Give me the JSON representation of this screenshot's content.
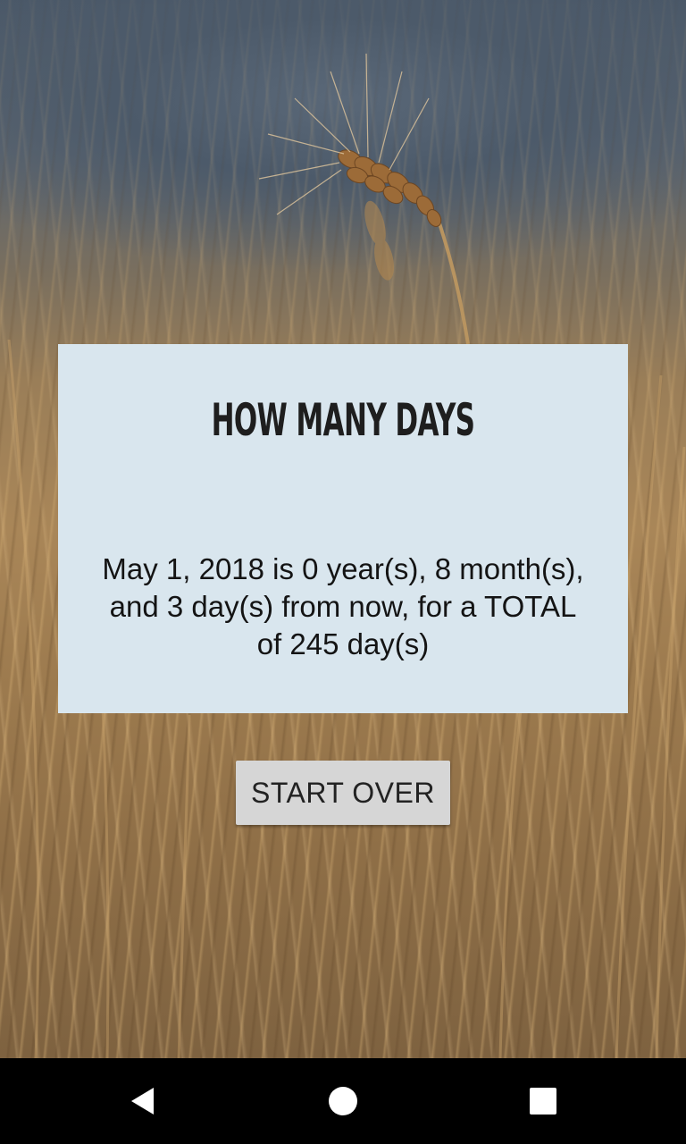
{
  "app": {
    "title": "HOW MANY DAYS"
  },
  "result": {
    "text": "May 1, 2018 is 0 year(s), 8 month(s), and 3 day(s)  from now, for a TOTAL of 245 day(s)",
    "card_color": "#d9e6ee"
  },
  "actions": {
    "start_over_label": "START OVER"
  },
  "background": {
    "image": "wheat-field-photo"
  },
  "navigation": {
    "icons": [
      "back-triangle-icon",
      "home-circle-icon",
      "recents-square-icon"
    ],
    "bar_color": "#000000"
  }
}
